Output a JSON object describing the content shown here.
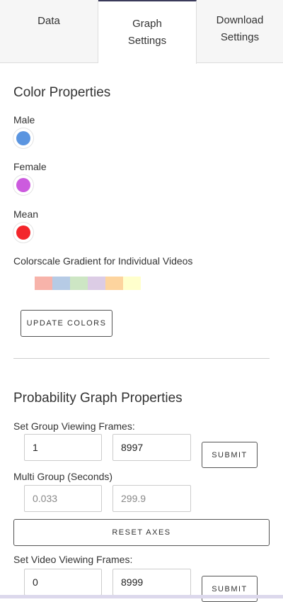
{
  "tabs": {
    "data": "Data",
    "graph_line1": "Graph",
    "graph_line2": "Settings",
    "download_line1": "Download",
    "download_line2": "Settings"
  },
  "color_properties": {
    "heading": "Color Properties",
    "male_label": "Male",
    "male_color": "#5b95e0",
    "female_label": "Female",
    "female_color": "#cc5bde",
    "mean_label": "Mean",
    "mean_color": "#f3262b",
    "gradient_label": "Colorscale Gradient for Individual Videos",
    "gradient_colors": [
      "#f7b3aa",
      "#b6cbe5",
      "#cde6c4",
      "#dccce5",
      "#fdd49e",
      "#ffffcc"
    ],
    "update_button": "UPDATE COLORS"
  },
  "probability_graph": {
    "heading": "Probability Graph Properties",
    "group_frames_label": "Set Group Viewing Frames:",
    "group_frame_start": "1",
    "group_frame_end": "8997",
    "group_submit": "SUBMIT",
    "multi_group_label": "Multi Group (Seconds)",
    "multi_group_start": "0.033",
    "multi_group_end": "299.9",
    "reset_axes": "RESET AXES",
    "video_frames_label": "Set Video Viewing Frames:",
    "video_frame_start": "0",
    "video_frame_end": "8999",
    "video_submit": "SUBMIT"
  }
}
